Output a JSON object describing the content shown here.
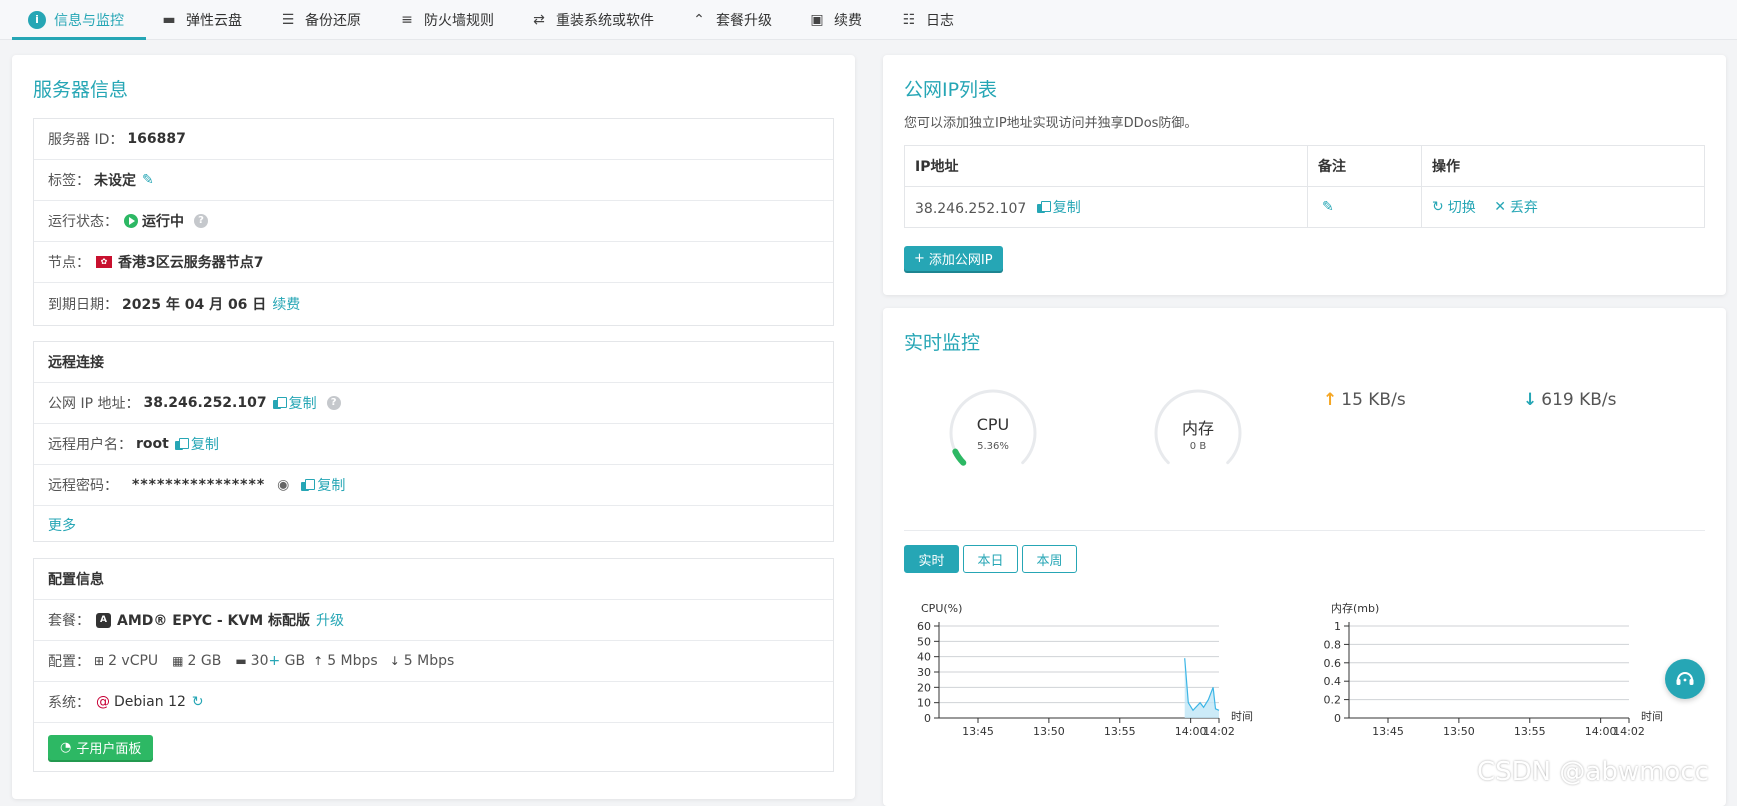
{
  "tabs": [
    {
      "label": "信息与监控",
      "icon": "info-icon",
      "active": true
    },
    {
      "label": "弹性云盘",
      "icon": "disk-icon"
    },
    {
      "label": "备份还原",
      "icon": "backup-icon"
    },
    {
      "label": "防火墙规则",
      "icon": "firewall-icon"
    },
    {
      "label": "重装系统或软件",
      "icon": "swap-icon"
    },
    {
      "label": "套餐升级",
      "icon": "upgrade-icon"
    },
    {
      "label": "续费",
      "icon": "money-icon"
    },
    {
      "label": "日志",
      "icon": "log-icon"
    }
  ],
  "server_info": {
    "title": "服务器信息",
    "id_label": "服务器 ID：",
    "id_value": "166887",
    "tag_label": "标签：",
    "tag_value": "未设定",
    "status_label": "运行状态：",
    "status_value": "运行中",
    "node_label": "节点：",
    "node_value": "香港3区云服务器节点7",
    "expire_label": "到期日期：",
    "expire_value": "2025 年 04 月 06 日",
    "renew_link": "续费"
  },
  "remote": {
    "head": "远程连接",
    "ip_label": "公网 IP 地址：",
    "ip_value": "38.246.252.107",
    "copy_label": "复制",
    "user_label": "远程用户名：",
    "user_value": "root",
    "pwd_label": "远程密码：",
    "pwd_value": "****************",
    "more_link": "更多"
  },
  "config": {
    "head": "配置信息",
    "plan_label": "套餐：",
    "plan_value": "AMD® EPYC - KVM 标配版",
    "upgrade_link": "升级",
    "spec_label": "配置：",
    "cpu": "2 vCPU",
    "ram": "2 GB",
    "disk_num": "30",
    "disk_plus": "+",
    "disk_unit": " GB",
    "up_bw": "5 Mbps",
    "down_bw": "5 Mbps",
    "os_label": "系统：",
    "os_value": "Debian 12",
    "subuser_button": "子用户面板"
  },
  "ip_list": {
    "title": "公网IP列表",
    "desc": "您可以添加独立IP地址实现访问并独享DDos防御。",
    "headers": [
      "IP地址",
      "备注",
      "操作"
    ],
    "row_ip": "38.246.252.107",
    "copy_label": "复制",
    "switch_label": "切换",
    "discard_label": "丢弃",
    "add_button": "添加公网IP"
  },
  "monitor": {
    "title": "实时监控",
    "cpu_label": "CPU",
    "cpu_value": "5.36%",
    "cpu_fraction": 0.0536,
    "mem_label": "内存",
    "mem_value": "0 B",
    "up_speed": "15 KB/s",
    "down_speed": "619 KB/s",
    "ranges": [
      "实时",
      "本日",
      "本周"
    ],
    "colors": {
      "accent": "#26a6b5",
      "gauge_fill": "#2db864",
      "up_arrow": "#f5a623"
    }
  },
  "chart_data": [
    {
      "type": "area",
      "ylabel": "CPU(%)",
      "xlabel": "时间",
      "yticks": [
        0,
        10,
        20,
        30,
        40,
        50,
        60
      ],
      "ylim": [
        0,
        60
      ],
      "xticks": [
        "13:45",
        "13:50",
        "13:55",
        "14:00",
        "14:02"
      ],
      "series": [
        {
          "points": [
            [
              "13:59:35",
              39
            ],
            [
              "13:59:50",
              10
            ],
            [
              "14:00:10",
              5
            ],
            [
              "14:00:40",
              10
            ],
            [
              "14:00:55",
              7
            ],
            [
              "14:01:15",
              12
            ],
            [
              "14:01:35",
              20
            ],
            [
              "14:01:45",
              6
            ],
            [
              "14:02:00",
              5
            ]
          ]
        }
      ]
    },
    {
      "type": "area",
      "ylabel": "内存(mb)",
      "xlabel": "时间",
      "yticks": [
        0,
        0.2,
        0.4,
        0.6,
        0.8,
        1
      ],
      "ylim": [
        0,
        1
      ],
      "xticks": [
        "13:45",
        "13:50",
        "13:55",
        "14:00",
        "14:02"
      ],
      "series": []
    }
  ],
  "watermark": "CSDN @abwmocc"
}
